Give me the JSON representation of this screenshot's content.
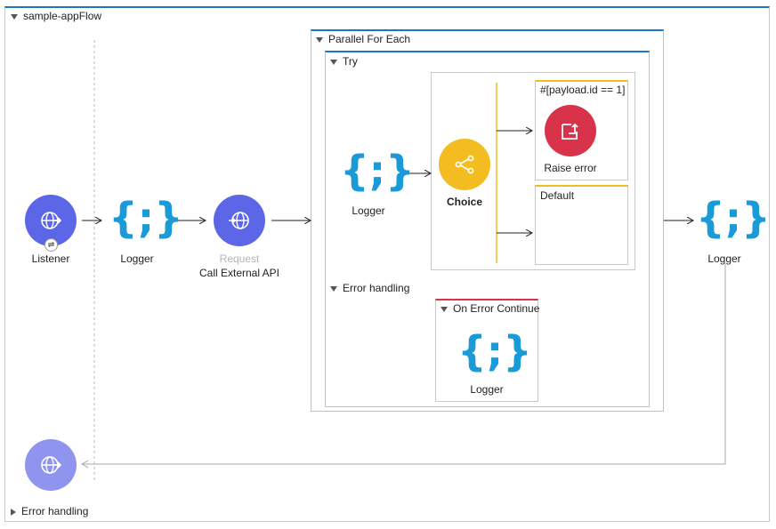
{
  "flow": {
    "name": "sample-appFlow",
    "error_handling_label": "Error handling"
  },
  "main": {
    "listener_label": "Listener",
    "logger1_label": "Logger",
    "request_title": "Request",
    "request_label": "Call External API",
    "logger_final_label": "Logger"
  },
  "parallel": {
    "title": "Parallel For Each",
    "try_label": "Try",
    "logger_label": "Logger",
    "choice_label": "Choice",
    "when_expression": "#[payload.id == 1]",
    "raise_error_label": "Raise error",
    "default_label": "Default",
    "error_handling_label": "Error handling",
    "on_error_continue_label": "On Error Continue",
    "on_error_logger_label": "Logger"
  },
  "colors": {
    "accent": "#1a75c4",
    "listener": "#5b67e6",
    "source_return": "#8f95ee",
    "logger": "#1a9bd7",
    "choice": "#f3bd22",
    "raise_error": "#d8334a",
    "on_error_border": "#d8334a"
  }
}
